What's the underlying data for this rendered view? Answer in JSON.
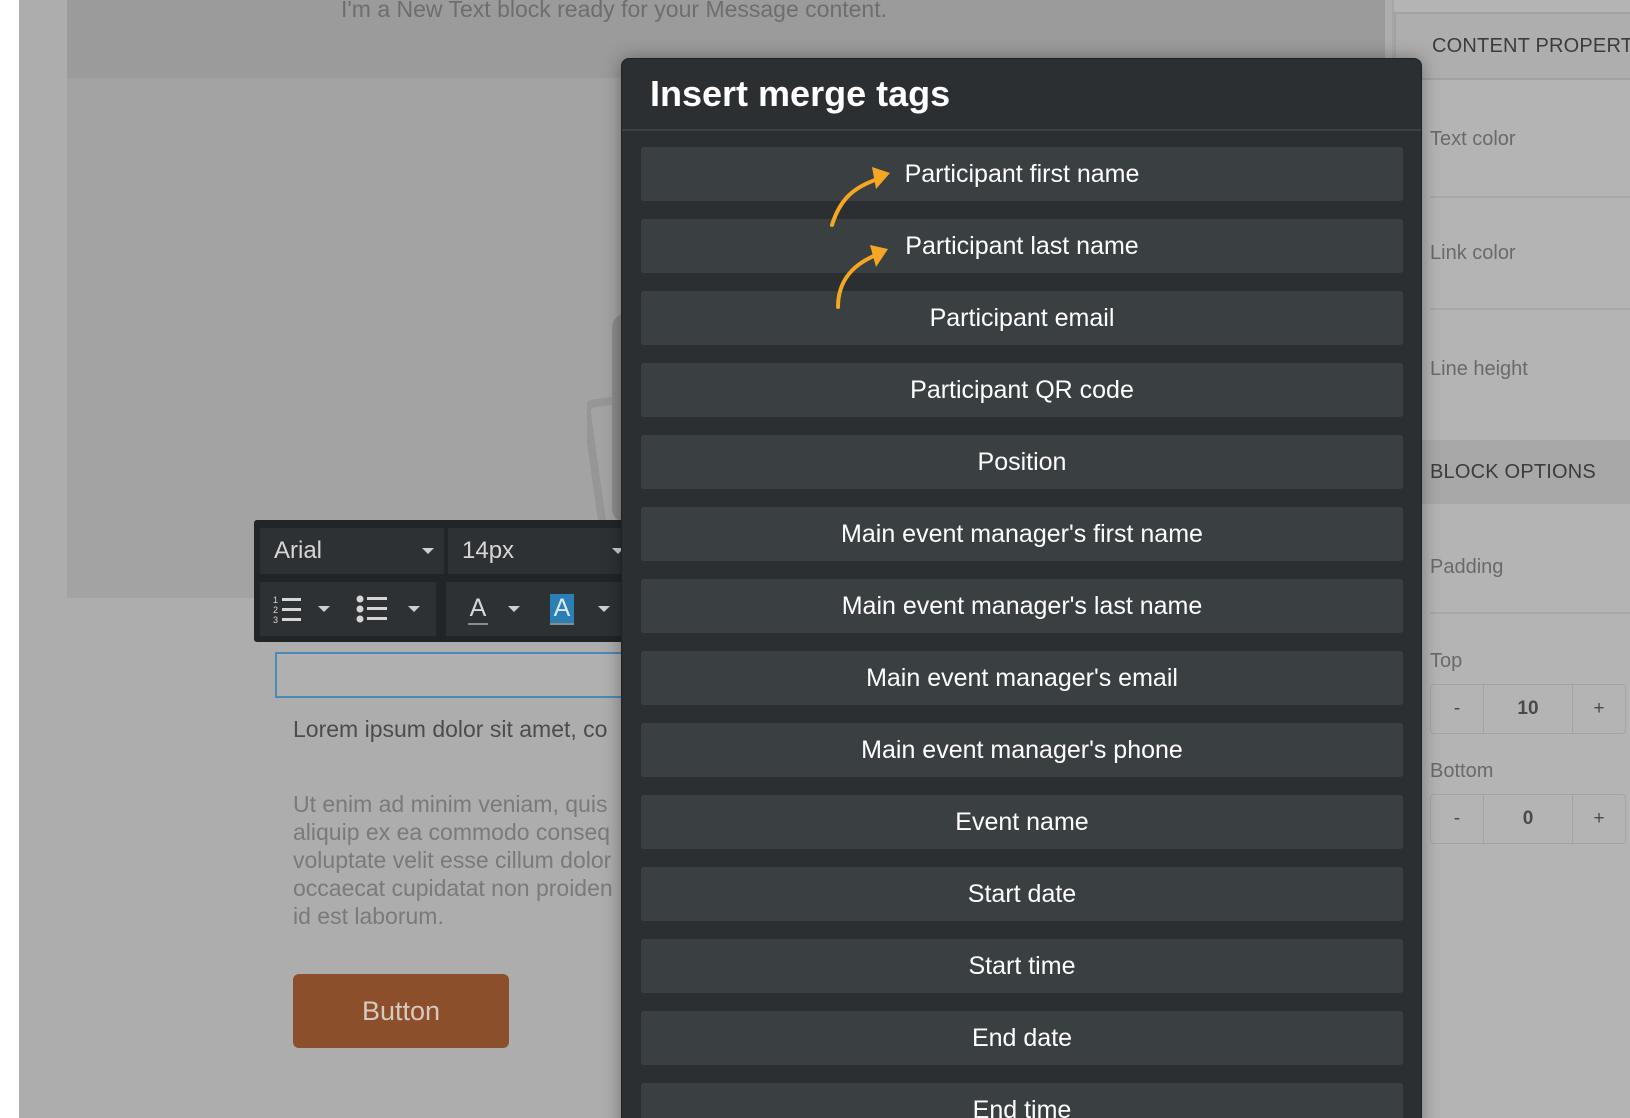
{
  "canvas": {
    "top_text": "I'm a New Text block ready for your Message content.",
    "lorem_line": "Lorem ipsum dolor sit amet, co",
    "lorem_paragraph": "Ut enim ad minim veniam, quis\naliquip ex ea commodo conseq\nvoluptate velit esse cillum dolor\noccaecat cupidatat non proiden\nid est laborum.",
    "button_label": "Button"
  },
  "toolbar": {
    "font": "Arial",
    "size": "14px",
    "text_color_glyph": "A",
    "bg_color_glyph": "A"
  },
  "modal": {
    "title": "Insert merge tags",
    "tags": [
      "Participant first name",
      "Participant last name",
      "Participant email",
      "Participant QR code",
      "Position",
      "Main event manager's first name",
      "Main event manager's last name",
      "Main event manager's email",
      "Main event manager's phone",
      "Event name",
      "Start date",
      "Start time",
      "End date",
      "End time"
    ]
  },
  "right_panel": {
    "content_header": "CONTENT PROPERTIES",
    "text_color": "Text color",
    "link_color": "Link color",
    "line_height": "Line height",
    "block_header": "BLOCK OPTIONS",
    "padding": "Padding",
    "top_label": "Top",
    "top_value": "10",
    "bottom_label": "Bottom",
    "bottom_value": "0",
    "minus": "-",
    "plus": "+"
  },
  "colors": {
    "accent_arrow": "#f5a623",
    "modal_bg": "#2b2f32",
    "tag_bg": "#3a3f42",
    "button_brown": "#8b4f2b"
  }
}
